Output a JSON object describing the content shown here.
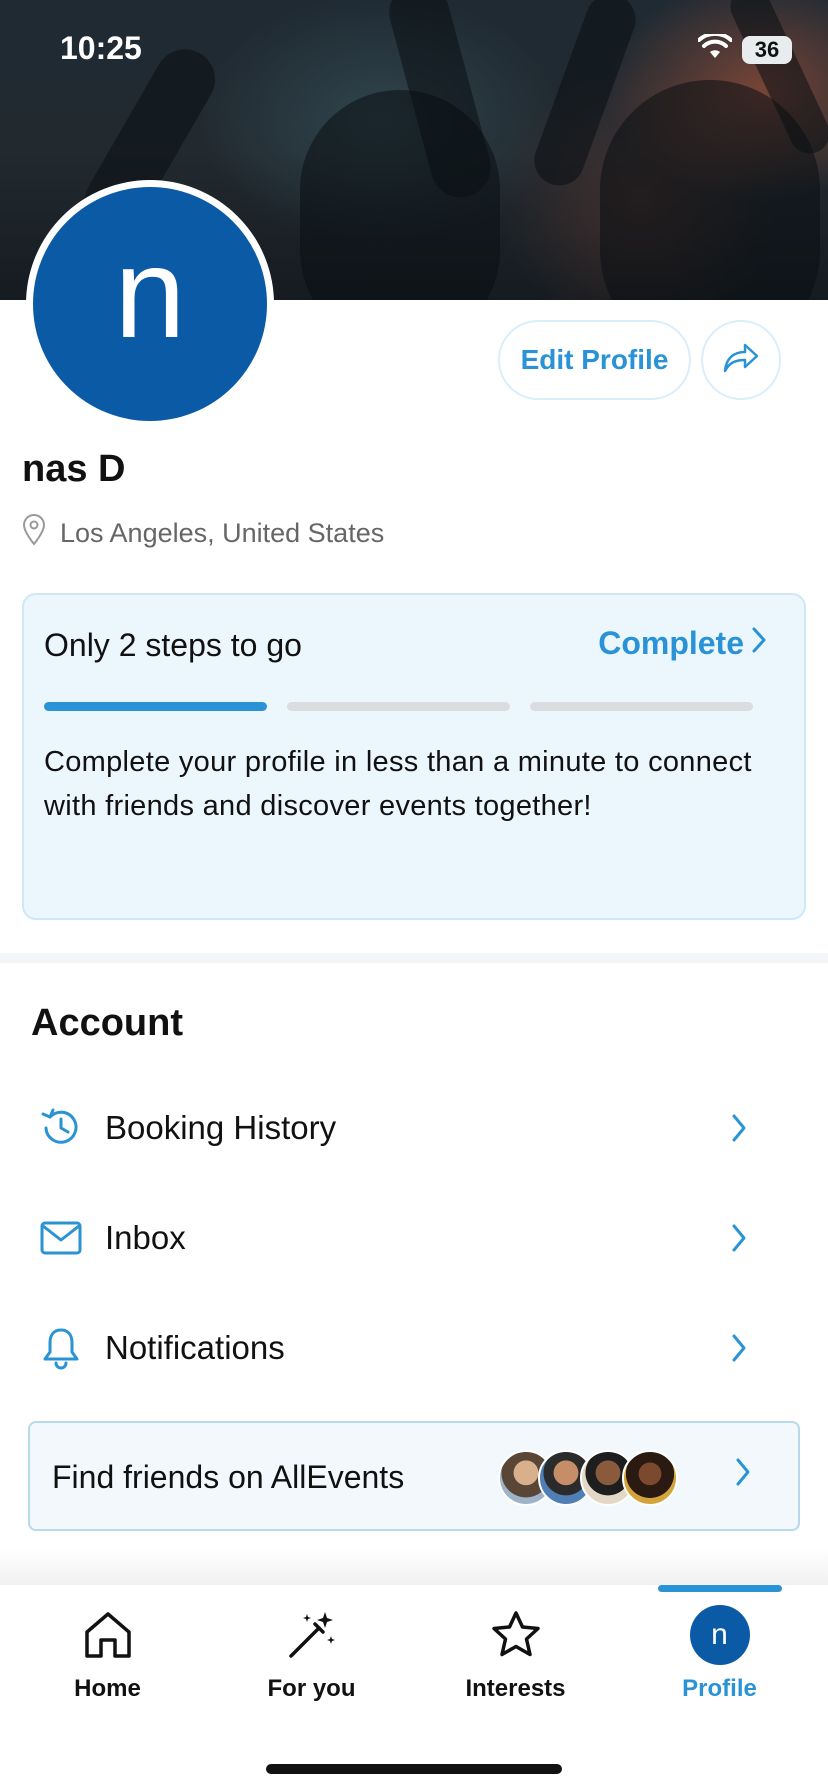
{
  "status_bar": {
    "time": "10:25",
    "battery": "36"
  },
  "profile": {
    "avatar_letter": "n",
    "name": "nas D",
    "location": "Los Angeles, United States",
    "edit_label": "Edit Profile"
  },
  "progress_card": {
    "title": "Only 2 steps to go",
    "action": "Complete",
    "steps_total": 3,
    "steps_done": 1,
    "body": "Complete your profile in less than a minute to connect with friends and discover events together!"
  },
  "account": {
    "title": "Account",
    "items": [
      {
        "label": "Booking History",
        "icon": "history-icon"
      },
      {
        "label": "Inbox",
        "icon": "mail-icon"
      },
      {
        "label": "Notifications",
        "icon": "bell-icon"
      }
    ]
  },
  "friends": {
    "label": "Find friends on AllEvents"
  },
  "nav": {
    "items": [
      {
        "label": "Home",
        "icon": "home-icon"
      },
      {
        "label": "For you",
        "icon": "magic-wand-icon"
      },
      {
        "label": "Interests",
        "icon": "star-icon"
      },
      {
        "label": "Profile",
        "icon": "avatar"
      }
    ],
    "active": "Profile"
  },
  "colors": {
    "accent": "#2a93d5",
    "avatar": "#0b5aa6",
    "card_bg": "#ebf6fd"
  }
}
